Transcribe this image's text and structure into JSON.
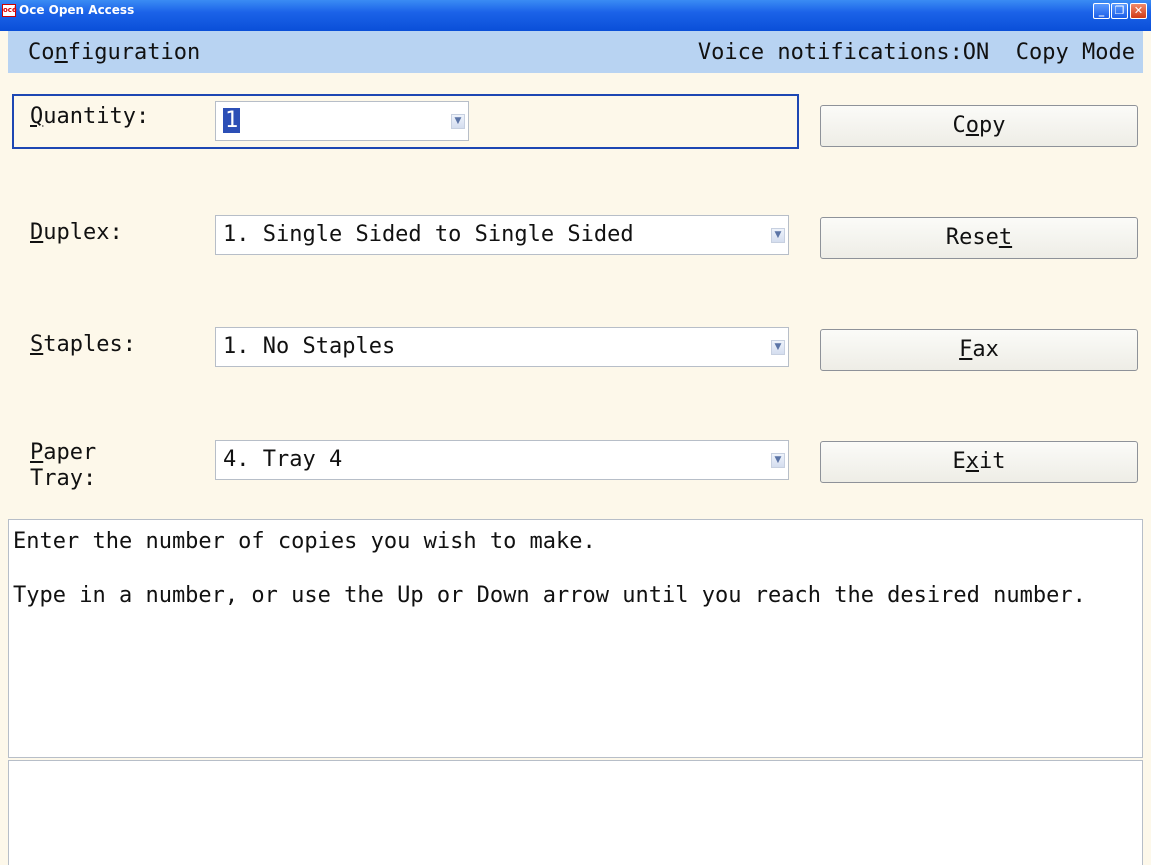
{
  "window": {
    "title": "Oce Open Access",
    "icon": "oce-logo-icon",
    "controls": {
      "minimize": "_",
      "maximize": "❐",
      "close": "✕"
    }
  },
  "header": {
    "section": "Configuration",
    "section_mnemonic_index": 2,
    "status": "Voice notifications:ON  Copy Mode"
  },
  "form": {
    "quantity": {
      "label": "Quantity:",
      "mnemonic": "Q",
      "value": "1"
    },
    "duplex": {
      "label": "Duplex:",
      "mnemonic": "D",
      "value": "1. Single Sided to Single Sided"
    },
    "staples": {
      "label": "Staples:",
      "mnemonic": "S",
      "value": "1. No Staples"
    },
    "paper_tray": {
      "label_line1": "Paper",
      "label_line2": "Tray:",
      "mnemonic": "P",
      "value": "4. Tray 4"
    }
  },
  "buttons": {
    "copy": "Copy",
    "reset": "Reset",
    "fax": "Fax",
    "exit": "Exit"
  },
  "help": {
    "line1": "Enter the number of copies you wish to make.",
    "line2": "Type in a number, or use the Up or Down arrow until you reach the desired number."
  },
  "status_text": "",
  "colors": {
    "titlebar": "#0a4fd8",
    "header_bg": "#b8d3f2",
    "focus_border": "#1d47b3",
    "page_bg": "#fdf8ea"
  }
}
